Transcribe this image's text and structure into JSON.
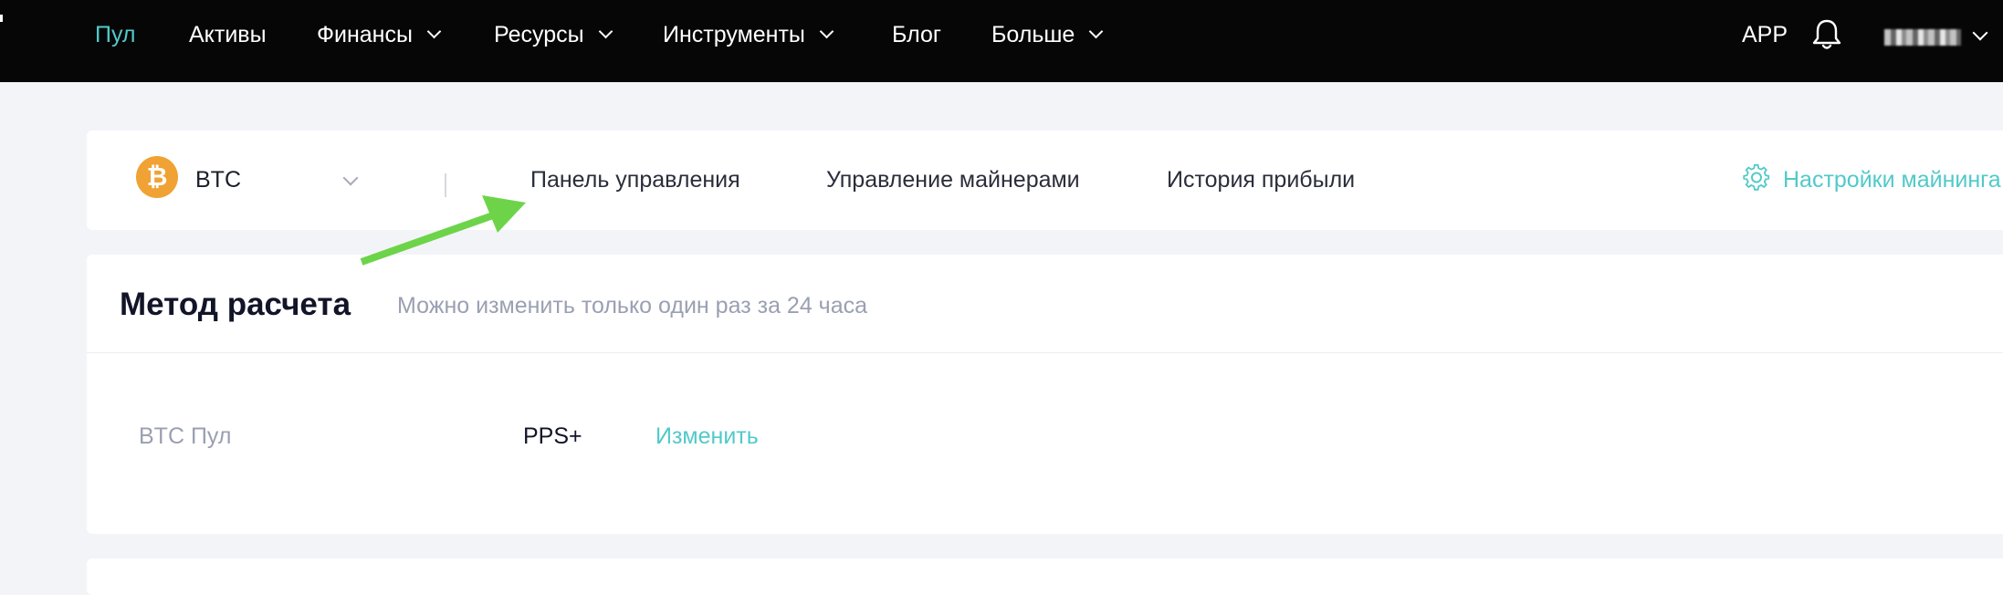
{
  "colors": {
    "topbar_bg": "#060606",
    "accent": "#52c9c9",
    "page_bg": "#f3f4f8",
    "bitcoin_orange": "#f0a234",
    "annotation_arrow": "#6dd44a"
  },
  "topnav": {
    "items": [
      {
        "label": "Пул",
        "active": true,
        "has_dropdown": false
      },
      {
        "label": "Активы",
        "active": false,
        "has_dropdown": false
      },
      {
        "label": "Финансы",
        "active": false,
        "has_dropdown": true
      },
      {
        "label": "Ресурсы",
        "active": false,
        "has_dropdown": true
      },
      {
        "label": "Инструменты",
        "active": false,
        "has_dropdown": true
      },
      {
        "label": "Блог",
        "active": false,
        "has_dropdown": false
      },
      {
        "label": "Больше",
        "active": false,
        "has_dropdown": true
      }
    ],
    "app_label": "APP",
    "bell_icon": "bell-icon",
    "user_icon": "blurred-username"
  },
  "coin_selector": {
    "icon": "bitcoin-icon",
    "icon_glyph": "₿",
    "name": "BTC"
  },
  "tabs": [
    {
      "label": "Панель управления",
      "active": true
    },
    {
      "label": "Управление майнерами",
      "active": false
    },
    {
      "label": "История прибыли",
      "active": false
    }
  ],
  "settings_link": {
    "icon": "gear-icon",
    "label": "Настройки майнинга"
  },
  "settlement": {
    "title": "Метод расчета",
    "note": "Можно изменить только один раз за 24 часа",
    "row": {
      "label": "BTC Пул",
      "value": "PPS+",
      "action": "Изменить"
    }
  }
}
